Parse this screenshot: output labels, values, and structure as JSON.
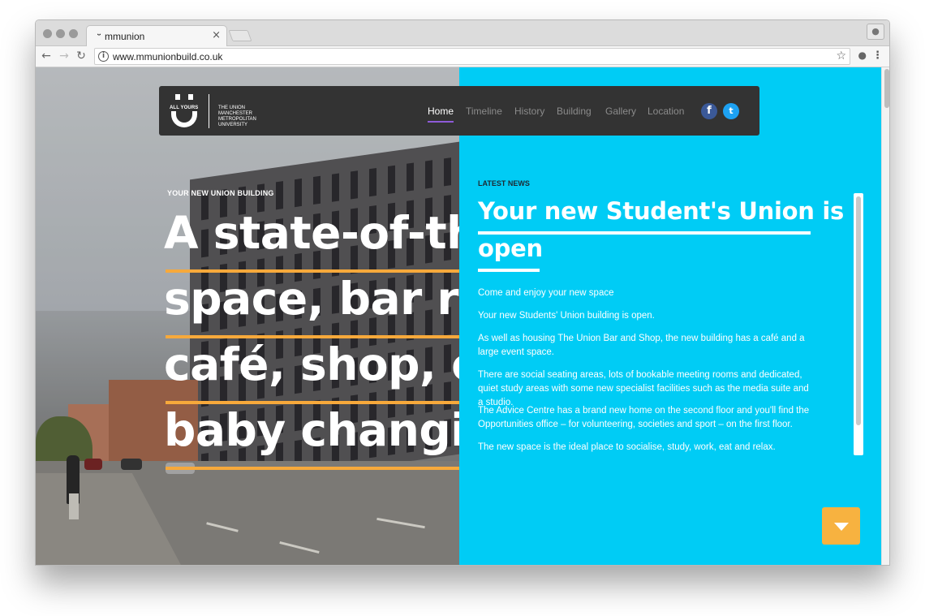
{
  "browser": {
    "tab_title": "mmunion",
    "tab_favicon": "ᵕ",
    "tab_close": "×",
    "url": "www.mmunionbuild.co.uk",
    "back_icon": "←",
    "forward_icon": "→",
    "reload_icon": "↻",
    "info_icon": "i",
    "star_icon": "☆",
    "extension_icon": "●",
    "menu_icon": "⋮",
    "profile_icon": "●"
  },
  "nav": {
    "logo_all_yours": "ALL YOURS",
    "logo_lines": [
      "THE UNION",
      "MANCHESTER",
      "METROPOLITAN",
      "UNIVERSITY"
    ],
    "items": [
      "Home",
      "Timeline",
      "History",
      "Building",
      "Gallery",
      "Location"
    ],
    "active_item": "Home",
    "active_underline_color": "#8e5bd8",
    "social": {
      "facebook_glyph": "f",
      "facebook_color": "#3b5998",
      "twitter_glyph": "t",
      "twitter_color": "#1da1f2"
    }
  },
  "hero": {
    "eyebrow": "YOUR NEW UNION BUILDING",
    "headline_lines": [
      "A state-of-the",
      "space, bar res",
      "café, shop, ca",
      "baby changin"
    ],
    "underline_color": "#f7a93b"
  },
  "news": {
    "eyebrow": "LATEST NEWS",
    "title_lines": [
      "Your new Student's Union is",
      "open"
    ],
    "paragraphs": [
      "Come and enjoy your new space",
      "Your new Students' Union building is open.",
      "As well as housing The Union Bar and Shop, the new building has a café and a large event space.",
      "There are social seating areas, lots of bookable meeting rooms and dedicated, quiet study areas with some new specialist facilities such as the media suite and a studio.",
      "The Advice Centre has a brand new home on the second floor and you'll find the Opportunities office – for volunteering, societies and sport – on the first floor.",
      "The new space is the ideal place to socialise, study, work, eat and relax."
    ],
    "panel_color": "#00ccf5",
    "scroll_button_color": "#f7b240"
  }
}
